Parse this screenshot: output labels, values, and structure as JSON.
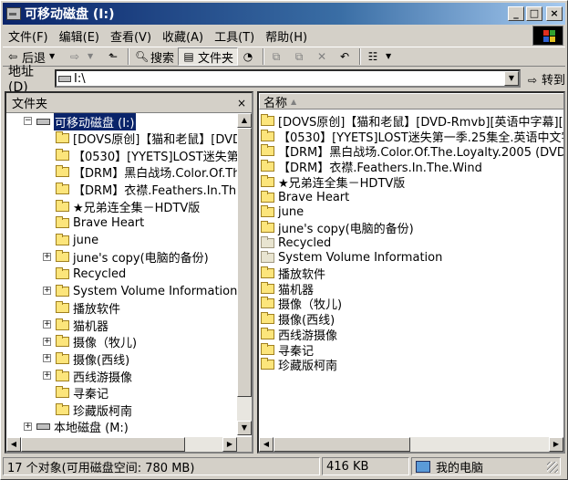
{
  "window": {
    "title": "可移动磁盘 (I:)",
    "buttons": {
      "minimize": "_",
      "maximize": "□",
      "close": "×"
    }
  },
  "menu": [
    "文件(F)",
    "编辑(E)",
    "查看(V)",
    "收藏(A)",
    "工具(T)",
    "帮助(H)"
  ],
  "toolbar": {
    "back": "后退",
    "search": "搜索",
    "folders": "文件夹"
  },
  "address": {
    "label": "地址(D)",
    "value": "I:\\",
    "go": "转到"
  },
  "left_pane": {
    "header": "文件夹",
    "close": "×",
    "tree": [
      {
        "label": "可移动磁盘 (I:)",
        "type": "drive",
        "selected": true,
        "expander": "−"
      },
      {
        "label": "[DOVS原创]【猫和老鼠】[DVD",
        "type": "folder"
      },
      {
        "label": "【0530】[YYETS]LOST迷失第",
        "type": "folder"
      },
      {
        "label": "【DRM】黑白战场.Color.Of.Th",
        "type": "folder"
      },
      {
        "label": "【DRM】衣襟.Feathers.In.Th",
        "type": "folder"
      },
      {
        "label": "★兄弟连全集－HDTV版",
        "type": "folder"
      },
      {
        "label": "Brave Heart",
        "type": "folder"
      },
      {
        "label": "june",
        "type": "folder"
      },
      {
        "label": "june's copy(电脑的备份)",
        "type": "folder",
        "expander": "+"
      },
      {
        "label": "Recycled",
        "type": "folder"
      },
      {
        "label": "System Volume Information",
        "type": "folder",
        "expander": "+"
      },
      {
        "label": "播放软件",
        "type": "folder"
      },
      {
        "label": "猫机器",
        "type": "folder",
        "expander": "+"
      },
      {
        "label": "摄像（牧儿)",
        "type": "folder",
        "expander": "+"
      },
      {
        "label": "摄像(西线)",
        "type": "folder",
        "expander": "+"
      },
      {
        "label": "西线游摄像",
        "type": "folder",
        "expander": "+"
      },
      {
        "label": "寻秦记",
        "type": "folder"
      },
      {
        "label": "珍藏版柯南",
        "type": "folder"
      },
      {
        "label": "本地磁盘 (M:)",
        "type": "drive",
        "expander": "+"
      }
    ]
  },
  "right_pane": {
    "column_name": "名称",
    "items": [
      {
        "label": "[DOVS原创]【猫和老鼠】[DVD-Rmvb][英语中字幕][1",
        "grey": false
      },
      {
        "label": "【0530】[YYETS]LOST迷失第一季.25集全.英语中文字",
        "grey": false
      },
      {
        "label": "【DRM】黑白战场.Color.Of.The.Loyalty.2005 (DVDS",
        "grey": false
      },
      {
        "label": "【DRM】衣襟.Feathers.In.The.Wind",
        "grey": false
      },
      {
        "label": "★兄弟连全集－HDTV版",
        "grey": false
      },
      {
        "label": "Brave Heart",
        "grey": false
      },
      {
        "label": "june",
        "grey": false
      },
      {
        "label": "june's copy(电脑的备份)",
        "grey": false
      },
      {
        "label": "Recycled",
        "grey": true
      },
      {
        "label": "System Volume Information",
        "grey": true
      },
      {
        "label": "播放软件",
        "grey": false
      },
      {
        "label": "猫机器",
        "grey": false
      },
      {
        "label": "摄像（牧儿)",
        "grey": false
      },
      {
        "label": "摄像(西线)",
        "grey": false
      },
      {
        "label": "西线游摄像",
        "grey": false
      },
      {
        "label": "寻秦记",
        "grey": false
      },
      {
        "label": "珍藏版柯南",
        "grey": false
      }
    ]
  },
  "status": {
    "objects": "17 个对象(可用磁盘空间: 780 MB)",
    "size": "416 KB",
    "location": "我的电脑"
  }
}
